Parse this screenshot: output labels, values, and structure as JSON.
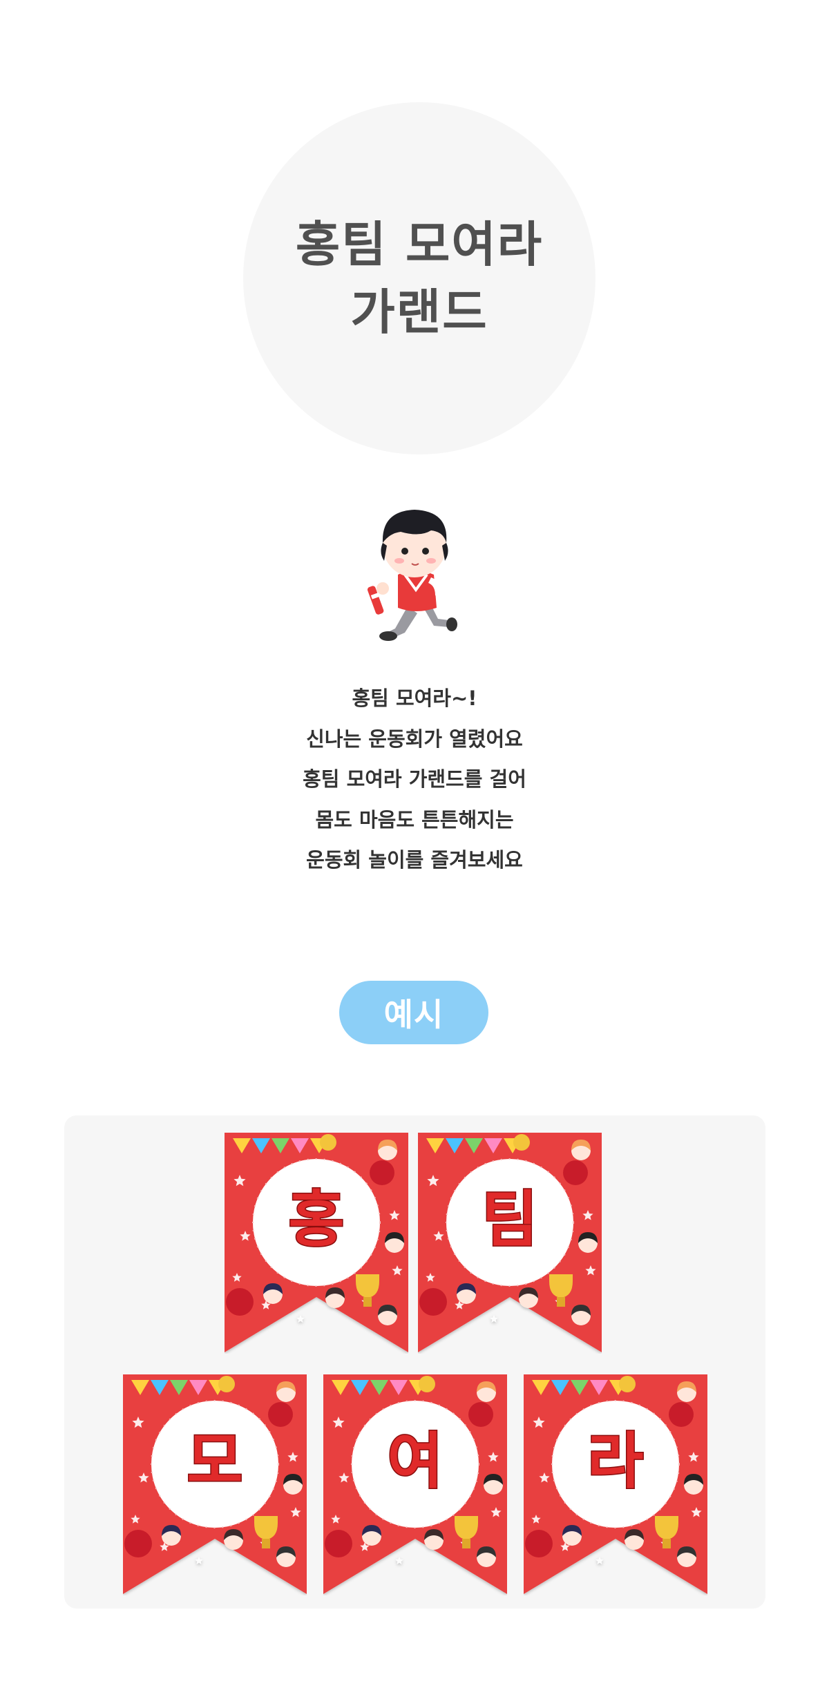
{
  "title": {
    "line1": "홍팀 모여라",
    "line2": "가랜드"
  },
  "description": [
    "홍팀 모여라~!",
    "신나는 운동회가 열렸어요",
    "홍팀 모여라 가랜드를 걸어",
    "몸도 마음도 튼튼해지는",
    "운동회 놀이를 즐겨보세요"
  ],
  "example_label": "예시",
  "flags": [
    "홍",
    "팀",
    "모",
    "여",
    "라"
  ],
  "colors": {
    "flag_red": "#e8403f",
    "letter_red": "#e02a2a",
    "badge_blue": "#8ccff7",
    "title_gray": "#505050"
  }
}
